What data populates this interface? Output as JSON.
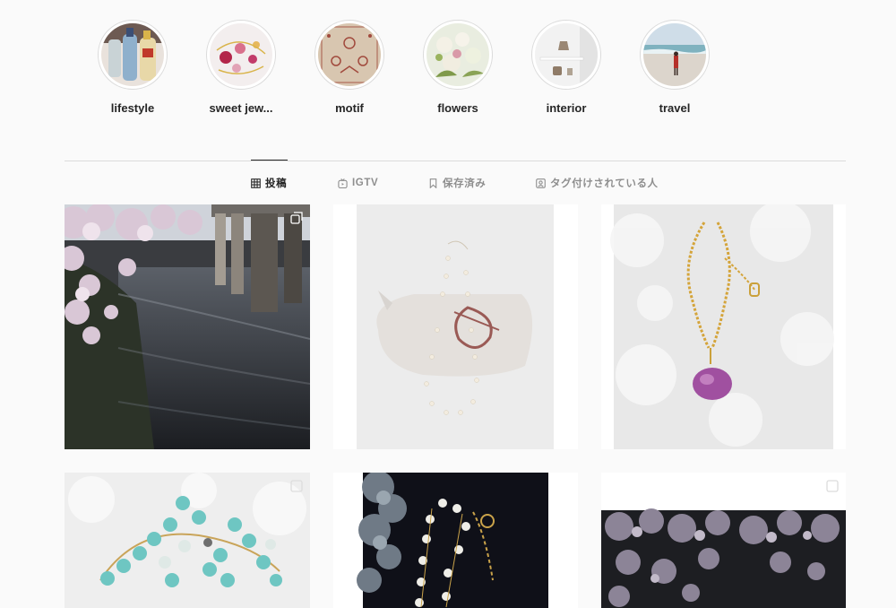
{
  "highlights": [
    {
      "label": "lifestyle"
    },
    {
      "label": "sweet jew..."
    },
    {
      "label": "motif"
    },
    {
      "label": "flowers"
    },
    {
      "label": "interior"
    },
    {
      "label": "travel"
    }
  ],
  "tabs": [
    {
      "label": "投稿",
      "icon": "grid-icon",
      "active": true
    },
    {
      "label": "IGTV",
      "icon": "igtv-icon",
      "active": false
    },
    {
      "label": "保存済み",
      "icon": "bookmark-icon",
      "active": false
    },
    {
      "label": "タグ付けされている人",
      "icon": "tagged-user-icon",
      "active": false
    }
  ],
  "posts": [
    {
      "subject": "cherry blossoms over canal",
      "icon": "carousel-icon"
    },
    {
      "subject": "pearl necklace on linen pouch"
    },
    {
      "subject": "gold chain with pink stone pendant"
    },
    {
      "subject": "turquoise bead bracelet",
      "icon": "carousel-icon"
    },
    {
      "subject": "pearl necklace on black with hydrangea"
    },
    {
      "subject": "cherry blossoms at night",
      "icon": "carousel-icon"
    }
  ],
  "colors": {
    "active_text": "#262626",
    "muted_text": "#8e8e8e",
    "border": "#dbdbdb",
    "background": "#fafafa"
  }
}
